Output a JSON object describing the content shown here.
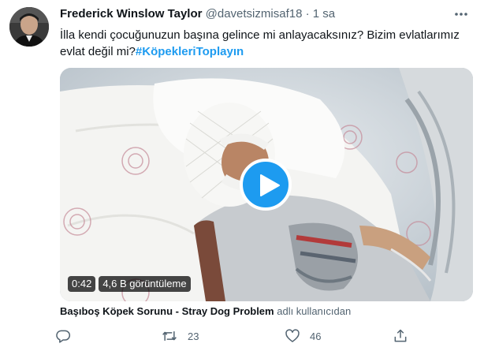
{
  "tweet": {
    "display_name": "Frederick Winslow Taylor",
    "handle": "@davetsizmisaf18",
    "separator": "·",
    "time": "1 sa",
    "text": "İlla kendi çocuğunuzun başına gelince mi anlayacaksınız? Bizim evlatlarımız evlat değil mi?",
    "hashtag": "#KöpekleriToplayın",
    "more_icon": "more-horizontal-icon",
    "avatar_icon": "profile-photo"
  },
  "video": {
    "duration": "0:42",
    "views": "4,6 B görüntüleme",
    "play_icon": "play-icon"
  },
  "attribution": {
    "source": "Başıboş Köpek Sorunu - Stray Dog Problem",
    "suffix": "adlı kullanıcıdan"
  },
  "actions": {
    "reply": {
      "icon": "reply-icon",
      "count": ""
    },
    "retweet": {
      "icon": "retweet-icon",
      "count": "23"
    },
    "like": {
      "icon": "heart-icon",
      "count": "46"
    },
    "share": {
      "icon": "share-icon",
      "count": ""
    }
  },
  "colors": {
    "accent": "#1d9bf0",
    "text": "#0f1419",
    "secondary": "#536471"
  }
}
